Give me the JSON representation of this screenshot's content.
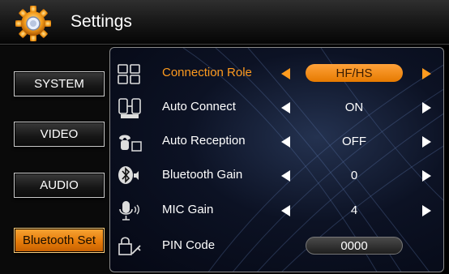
{
  "header": {
    "title": "Settings",
    "icon": "gear-icon"
  },
  "sidebar": {
    "items": [
      {
        "label": "SYSTEM",
        "active": false
      },
      {
        "label": "VIDEO",
        "active": false
      },
      {
        "label": "AUDIO",
        "active": false
      },
      {
        "label": "Bluetooth Set",
        "active": true
      }
    ]
  },
  "settings": {
    "rows": [
      {
        "label": "Connection Role",
        "value": "HF/HS",
        "icon": "phone-pair-icon",
        "selected": true
      },
      {
        "label": "Auto Connect",
        "value": "ON",
        "icon": "auto-connect-icon",
        "selected": false
      },
      {
        "label": "Auto Reception",
        "value": "OFF",
        "icon": "phone-answer-icon",
        "selected": false
      },
      {
        "label": "Bluetooth Gain",
        "value": "0",
        "icon": "bluetooth-volume-icon",
        "selected": false
      },
      {
        "label": "MIC Gain",
        "value": "4",
        "icon": "microphone-icon",
        "selected": false
      },
      {
        "label": "PIN Code",
        "value": "0000",
        "icon": "pin-key-icon",
        "selected": false
      }
    ]
  },
  "colors": {
    "accent": "#ff9b1f",
    "panel_bg": "#0c1224",
    "text": "#ffffff"
  }
}
